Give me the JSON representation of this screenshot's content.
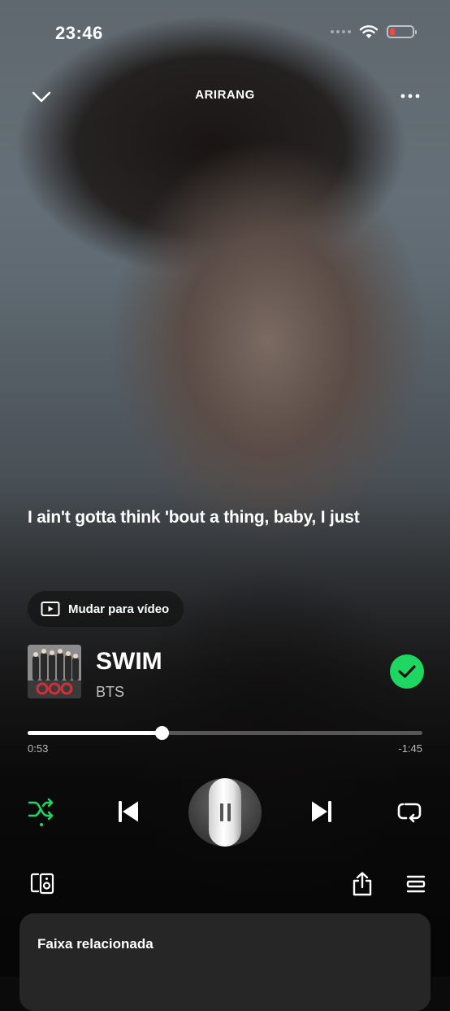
{
  "status_bar": {
    "time": "23:46"
  },
  "header": {
    "album_title": "ARIRANG"
  },
  "lyrics": {
    "current_line": "I ain't gotta think 'bout a thing, baby, I just"
  },
  "video_switch": {
    "label": "Mudar para vídeo"
  },
  "track": {
    "title": "SWIM",
    "artist": "BTS",
    "liked": true
  },
  "playback": {
    "elapsed": "0:53",
    "remaining": "-1:45",
    "progress_fraction": 0.34,
    "state": "playing"
  },
  "controls": {
    "shuffle_active": true,
    "icons": [
      "shuffle-icon",
      "previous-icon",
      "pause-icon",
      "next-icon",
      "repeat-icon"
    ]
  },
  "bottom_bar": {
    "icons": [
      "connect-device-icon",
      "share-icon",
      "queue-icon"
    ]
  },
  "related_panel": {
    "title": "Faixa relacionada"
  },
  "colors": {
    "accent_green": "#1ed760",
    "battery_low": "#ff453a"
  }
}
